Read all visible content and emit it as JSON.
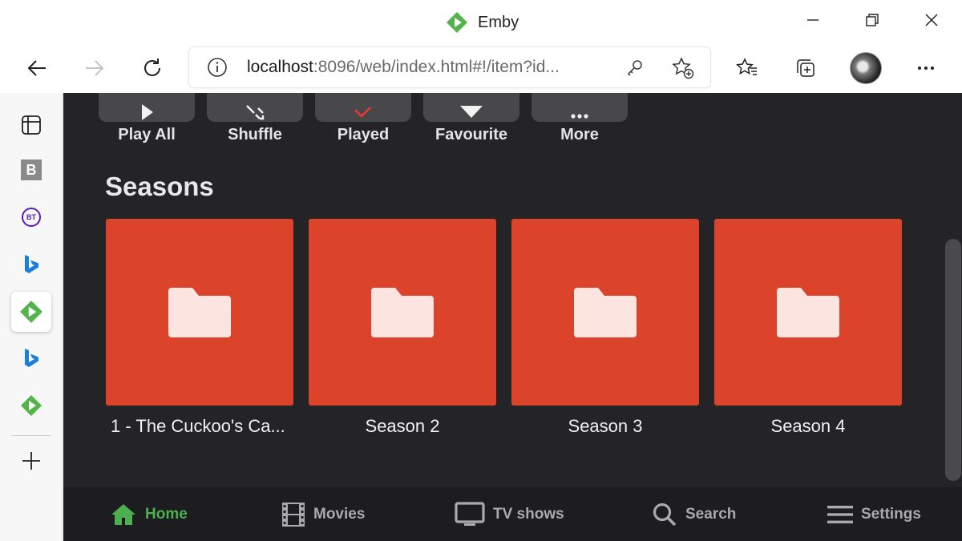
{
  "window": {
    "title": "Emby",
    "minimize_icon": "minimize-icon",
    "restore_icon": "restore-icon",
    "close_icon": "close-icon"
  },
  "toolbar": {
    "address_host": "localhost",
    "address_rest": ":8096/web/index.html#!/item?id..."
  },
  "actions": [
    {
      "label": "Play All",
      "icon": "play-icon"
    },
    {
      "label": "Shuffle",
      "icon": "shuffle-icon"
    },
    {
      "label": "Played",
      "icon": "check-icon"
    },
    {
      "label": "Favourite",
      "icon": "heart-icon"
    },
    {
      "label": "More",
      "icon": "more-icon"
    }
  ],
  "section": {
    "title": "Seasons"
  },
  "seasons": [
    {
      "label": "1 - The Cuckoo's Ca..."
    },
    {
      "label": "Season 2"
    },
    {
      "label": "Season 3"
    },
    {
      "label": "Season 4"
    }
  ],
  "bottom_nav": [
    {
      "label": "Home",
      "icon": "home-icon",
      "active": true
    },
    {
      "label": "Movies",
      "icon": "film-icon"
    },
    {
      "label": "TV shows",
      "icon": "tv-icon"
    },
    {
      "label": "Search",
      "icon": "search-icon"
    },
    {
      "label": "Settings",
      "icon": "menu-icon"
    }
  ],
  "sidebar": {
    "b_badge": "B",
    "bt_badge": "BT"
  },
  "colors": {
    "accent": "#4caf50",
    "card": "#db432b",
    "background": "#242426"
  }
}
